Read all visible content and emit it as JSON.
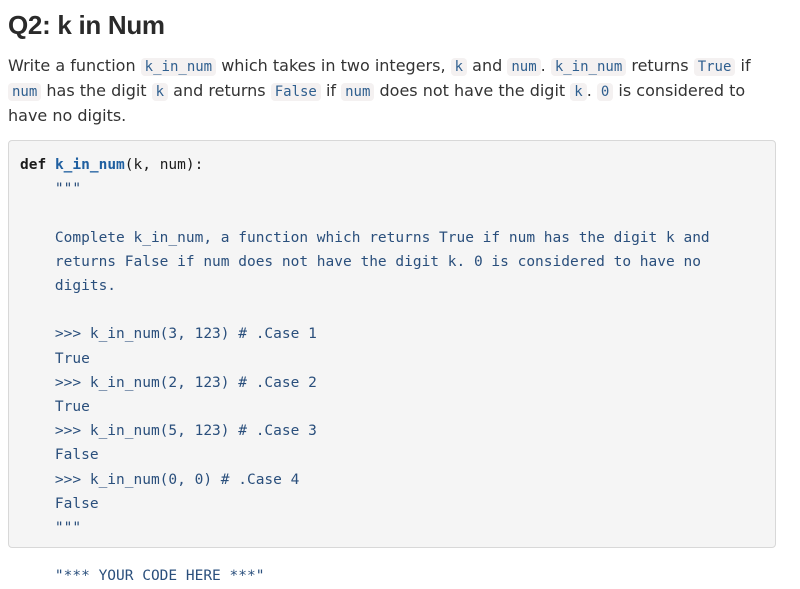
{
  "heading": "Q2: k in Num",
  "description": {
    "segments": [
      {
        "t": "Write a function ",
        "code": false
      },
      {
        "t": "k_in_num",
        "code": true
      },
      {
        "t": " which takes in two integers, ",
        "code": false
      },
      {
        "t": "k",
        "code": true
      },
      {
        "t": " and ",
        "code": false
      },
      {
        "t": "num",
        "code": true
      },
      {
        "t": ". ",
        "code": false
      },
      {
        "t": "k_in_num",
        "code": true
      },
      {
        "t": " returns ",
        "code": false
      },
      {
        "t": "True",
        "code": true
      },
      {
        "t": " if ",
        "code": false
      },
      {
        "t": "num",
        "code": true
      },
      {
        "t": " has the digit ",
        "code": false
      },
      {
        "t": "k",
        "code": true
      },
      {
        "t": " and returns ",
        "code": false
      },
      {
        "t": "False",
        "code": true
      },
      {
        "t": " if ",
        "code": false
      },
      {
        "t": "num",
        "code": true
      },
      {
        "t": " does not have the digit ",
        "code": false
      },
      {
        "t": "k",
        "code": true
      },
      {
        "t": ". ",
        "code": false
      },
      {
        "t": "0",
        "code": true
      },
      {
        "t": " is considered to have no digits.",
        "code": false
      }
    ]
  },
  "code": {
    "def_keyword": "def",
    "function_name": "k_in_num",
    "signature_rest": "(k, num):",
    "indent": "    ",
    "docstring_lines": [
      "\"\"\"",
      "",
      "Complete k_in_num, a function which returns True if num has the digit k and",
      "returns False if num does not have the digit k. 0 is considered to have no",
      "digits.",
      "",
      ">>> k_in_num(3, 123) # .Case 1",
      "True",
      ">>> k_in_num(2, 123) # .Case 2",
      "True",
      ">>> k_in_num(5, 123) # .Case 3",
      "False",
      ">>> k_in_num(0, 0) # .Case 4",
      "False",
      "\"\"\"",
      "",
      "\"*** YOUR CODE HERE ***\""
    ]
  }
}
